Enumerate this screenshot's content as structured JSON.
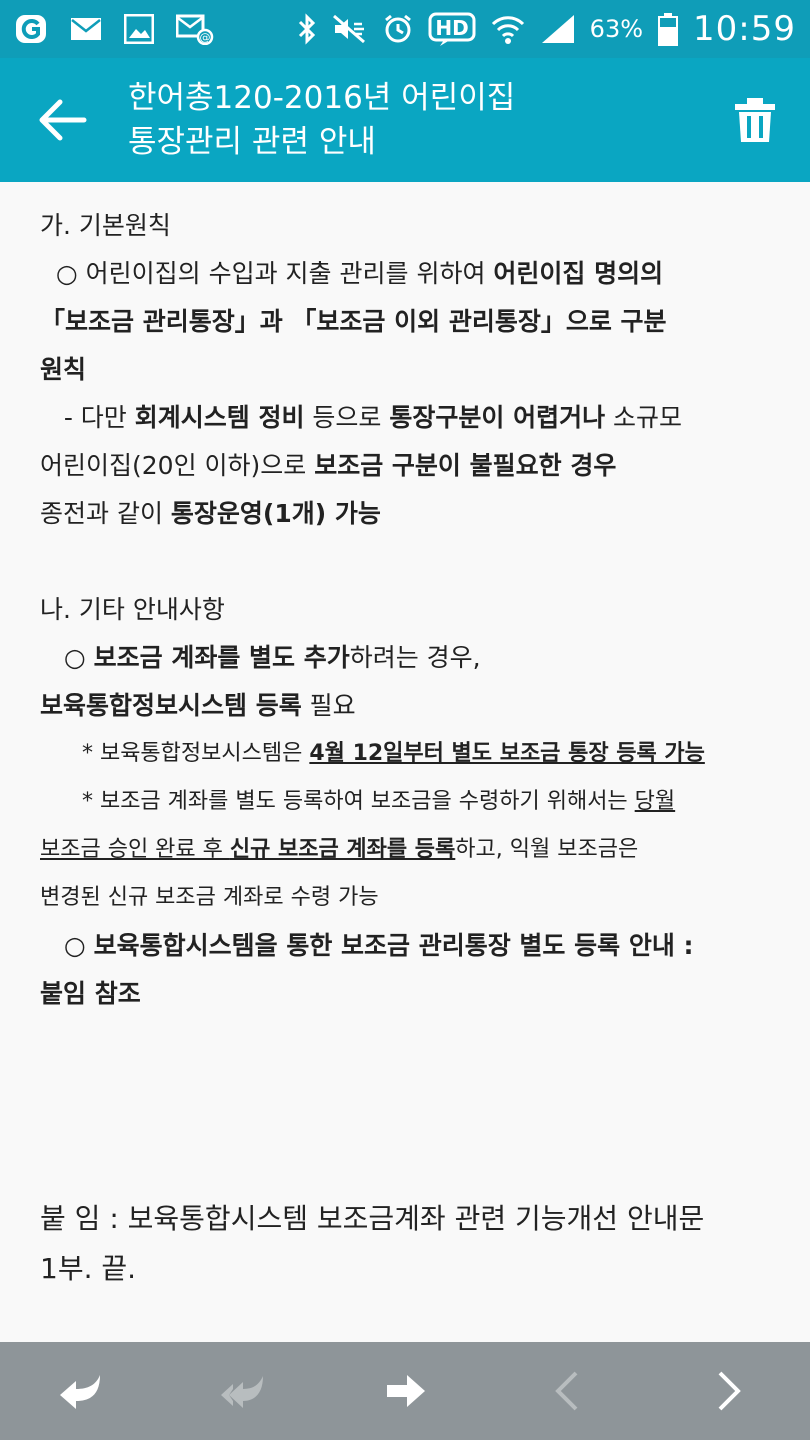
{
  "status_bar": {
    "battery": "63%",
    "time": "10:59",
    "icons": [
      "app-icon",
      "mail-icon",
      "gallery-icon",
      "email-alert-icon",
      "bluetooth-icon",
      "mute-icon",
      "alarm-icon",
      "hd-icon",
      "wifi-icon",
      "signal-icon",
      "battery-icon"
    ]
  },
  "app_bar": {
    "title_line1": "한어총120-2016년 어린이집",
    "title_line2": "통장관리 관련 안내",
    "background": "#0aa6c2"
  },
  "body": {
    "l1": "가. 기본원칙",
    "l2a": "  ○ 어린이집의 수입과 지출 관리를 위하여 ",
    "l2b": "어린이집 명의의",
    "l3": "「보조금 관리통장」과 「보조금 이외 관리통장」으로 구분",
    "l4": "원칙",
    "l5a": "   - 다만 ",
    "l5b": "회계시스템 정비",
    "l5c": " 등으로 ",
    "l5d": "통장구분이 어렵거나",
    "l5e": " 소규모",
    "l6a": "어린이집(20인 이하)으로 ",
    "l6b": "보조금 구분이 불필요한 경우",
    "l7a": "종전과 같이 ",
    "l7b": "통장운영(1개) 가능",
    "l8": "나. 기타 안내사항",
    "l9a": "   ○ ",
    "l9b": "보조금 계좌를 별도 추가",
    "l9c": "하려는 경우,",
    "l10a": "보육통합정보시스템 등록",
    "l10b": " 필요",
    "l11a": "      * 보육통합정보시스템은 ",
    "l11b": "4월 12일부터 별도 보조금 통장 등록 가능",
    "l12a": "      * 보조금 계좌를 별도 등록하여 보조금을 수령하기 위해서는 ",
    "l12b": "당월",
    "l13a": "보조금 승인 완료 후 ",
    "l13b": "신규 보조금 계좌를 등록",
    "l13c": "하고, 익월 보조금은",
    "l14": "변경된 신규 보조금 계좌로 수령 가능",
    "l15a": "   ○ ",
    "l15b": "보육통합시스템을 통한 보조금 관리통장 별도 등록 안내 :",
    "l16": "붙임 참조",
    "f1": "붙 임 : 보육통합시스템 보조금계좌 관련 기능개선 안내문",
    "f2": "1부.  끝."
  },
  "bottom_bar": {
    "buttons": [
      "reply-icon",
      "reply-all-icon",
      "forward-icon",
      "previous-icon",
      "next-icon"
    ]
  }
}
